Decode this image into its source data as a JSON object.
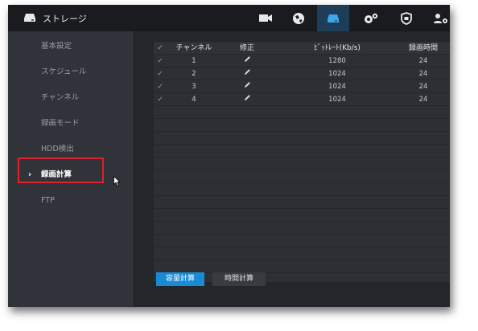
{
  "header": {
    "title": "ストレージ",
    "nav_icons": [
      "camera-icon",
      "network-icon",
      "storage-icon",
      "system-gear-icon",
      "security-shield-icon",
      "account-icon"
    ]
  },
  "sidebar": {
    "items": [
      {
        "label": "基本設定"
      },
      {
        "label": "スケジュール"
      },
      {
        "label": "チャンネル"
      },
      {
        "label": "録画モード"
      },
      {
        "label": "HDD検出"
      },
      {
        "label": "録画計算"
      },
      {
        "label": "FTP"
      }
    ],
    "active_index": 5
  },
  "table": {
    "headers": {
      "check": "✓",
      "channel": "チャンネル",
      "edit": "修正",
      "bitrate": "ﾋﾞｯﾄﾚｰﾄ(Kb/s)",
      "record_time": "録画時間"
    },
    "rows": [
      {
        "check": "✓",
        "channel": "1",
        "bitrate": "1280",
        "record_time": "24"
      },
      {
        "check": "✓",
        "channel": "2",
        "bitrate": "1024",
        "record_time": "24"
      },
      {
        "check": "✓",
        "channel": "3",
        "bitrate": "1024",
        "record_time": "24"
      },
      {
        "check": "✓",
        "channel": "4",
        "bitrate": "1024",
        "record_time": "24"
      }
    ]
  },
  "buttons": {
    "capacity_calc": "容量計算",
    "time_calc": "時間計算"
  },
  "colors": {
    "accent": "#1a8ad4",
    "highlight_box": "#e0202a",
    "active_tab": "#1d3d59"
  }
}
